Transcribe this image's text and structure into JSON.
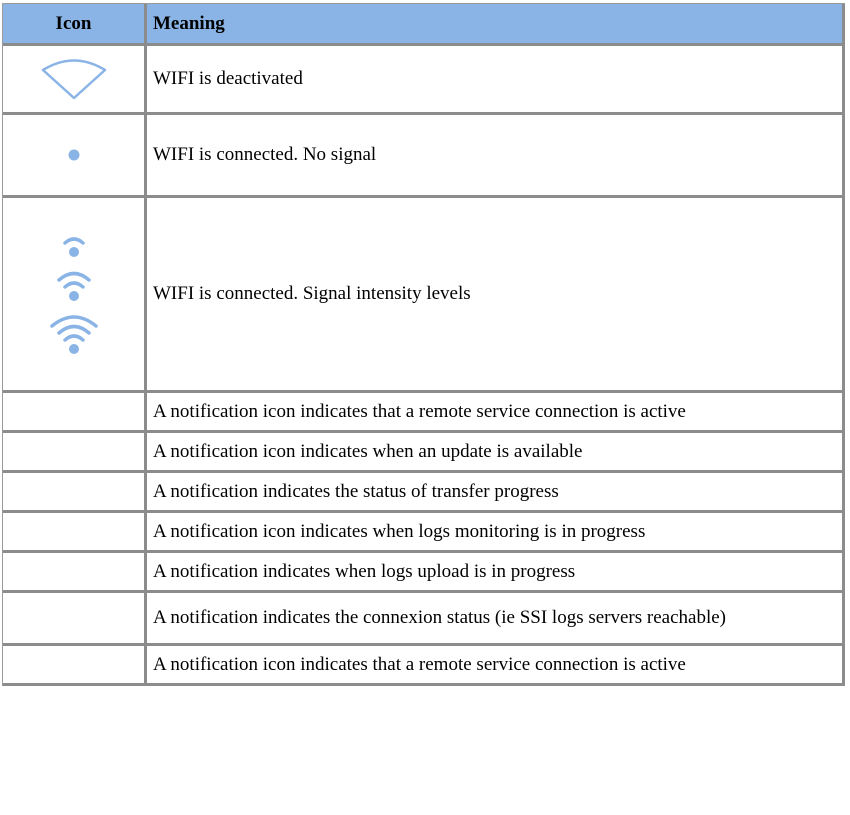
{
  "table": {
    "headers": {
      "icon": "Icon",
      "meaning": "Meaning"
    },
    "rows": [
      {
        "icon": "wifi-deactivated-icon",
        "meaning": "WIFI is deactivated"
      },
      {
        "icon": "wifi-no-signal-icon",
        "meaning": "WIFI is connected. No signal"
      },
      {
        "icon": [
          "wifi-signal-low-icon",
          "wifi-signal-medium-icon",
          "wifi-signal-high-icon"
        ],
        "meaning": "WIFI is connected. Signal intensity levels"
      },
      {
        "icon": "",
        "meaning": "A notification icon indicates that a remote service connection is active"
      },
      {
        "icon": "",
        "meaning": "A notification icon indicates when an update is available"
      },
      {
        "icon": "",
        "meaning": "A notification indicates the status of transfer progress"
      },
      {
        "icon": "",
        "meaning": "A notification icon indicates when logs monitoring is in progress"
      },
      {
        "icon": "",
        "meaning": "A notification indicates when logs upload is in progress"
      },
      {
        "icon": "",
        "meaning": "A notification indicates the connexion status (ie SSI logs servers reachable)"
      },
      {
        "icon": "",
        "meaning": "A notification icon indicates that a remote service connection is active"
      }
    ]
  },
  "colors": {
    "header_bg": "#8ab4e6",
    "icon_color": "#8ab4e6",
    "border": "#8c8c8c"
  }
}
